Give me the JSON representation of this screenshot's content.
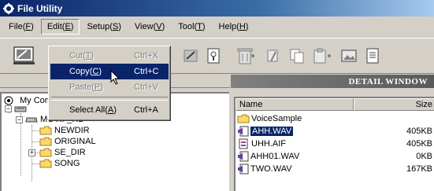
{
  "window": {
    "title": "File Utility"
  },
  "menubar": [
    {
      "label": "File",
      "key": "F"
    },
    {
      "label": "Edit",
      "key": "E"
    },
    {
      "label": "Setup",
      "key": "S"
    },
    {
      "label": "View",
      "key": "V"
    },
    {
      "label": "Tool",
      "key": "T"
    },
    {
      "label": "Help",
      "key": "H"
    }
  ],
  "edit_menu": {
    "items": [
      {
        "label": "Cut",
        "key": "T",
        "shortcut": "Ctrl+X",
        "state": "disabled"
      },
      {
        "label": "Copy",
        "key": "C",
        "shortcut": "Ctrl+C",
        "state": "highlighted"
      },
      {
        "label": "Paste",
        "key": "P",
        "shortcut": "Ctrl+V",
        "state": "disabled"
      },
      {
        "label": "Select All",
        "key": "A",
        "shortcut": "Ctrl+A",
        "state": "enabled"
      }
    ]
  },
  "detail_window": {
    "title": "DETAIL WINDOW"
  },
  "tree": {
    "root_label": "My Computer",
    "drive_label": "MOTIF_HD",
    "folders": [
      "NEWDIR",
      "ORIGINAL",
      "SE_DIR",
      "SONG"
    ]
  },
  "file_list": {
    "columns": {
      "name": "Name",
      "size": "Size"
    },
    "rows": [
      {
        "name": "VoiceSample",
        "size": "",
        "icon": "folder-icon",
        "selected": false
      },
      {
        "name": "AHH.WAV",
        "size": "405KB",
        "icon": "wav-file-icon",
        "selected": true
      },
      {
        "name": "UHH.AIF",
        "size": "405KB",
        "icon": "aif-file-icon",
        "selected": false
      },
      {
        "name": "AHH01.WAV",
        "size": "0KB",
        "icon": "wav-file-icon",
        "selected": false
      },
      {
        "name": "TWO.WAV",
        "size": "167KB",
        "icon": "wav-file-icon",
        "selected": false
      }
    ]
  },
  "colors": {
    "titlebar_start": "#0a246a",
    "selection": "#0a246a",
    "chrome": "#d4d0c8",
    "folder": "#ffd867"
  }
}
